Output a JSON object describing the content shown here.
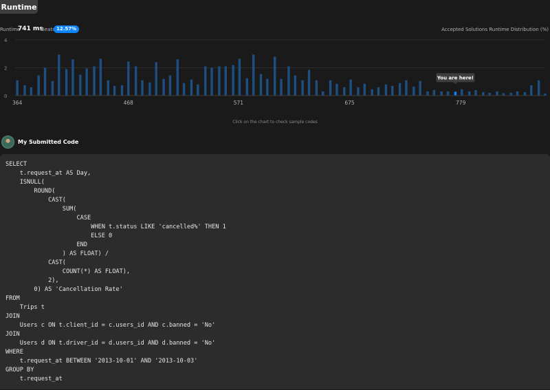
{
  "tabs": {
    "runtime": "Runtime"
  },
  "stats": {
    "runtime_label": "Runtime",
    "runtime_value": "741 ms",
    "beats_label": "Beats",
    "beats_value": "12.57%",
    "distribution_label": "Accepted Solutions Runtime Distribution (%)"
  },
  "chart_data": {
    "type": "bar",
    "ylim": [
      0,
      4
    ],
    "yticks": [
      "0",
      "2",
      "4"
    ],
    "xlim": [
      362,
      858
    ],
    "xticks": [
      364,
      468,
      571,
      675,
      779
    ],
    "grid": true,
    "bar_color": "#1e4f82",
    "highlight_color": "#0a84ff",
    "annotation": "You are here!",
    "highlight_index": 63,
    "x": [
      364,
      371,
      377,
      384,
      390,
      397,
      403,
      410,
      416,
      423,
      429,
      436,
      442,
      449,
      455,
      462,
      468,
      475,
      481,
      488,
      494,
      501,
      507,
      514,
      520,
      527,
      533,
      540,
      546,
      553,
      559,
      566,
      572,
      579,
      585,
      592,
      598,
      605,
      611,
      618,
      624,
      631,
      637,
      644,
      650,
      657,
      663,
      670,
      676,
      683,
      689,
      696,
      702,
      709,
      715,
      722,
      728,
      735,
      741,
      748,
      754,
      761,
      767,
      774,
      780,
      787,
      793,
      800,
      806,
      813,
      819,
      826,
      832,
      839,
      845,
      852,
      858
    ],
    "values": [
      1.1,
      0.75,
      0.6,
      1.45,
      2.0,
      1.05,
      2.95,
      1.9,
      2.6,
      1.5,
      1.95,
      2.1,
      2.65,
      1.1,
      0.7,
      0.75,
      2.45,
      2.1,
      1.1,
      0.95,
      2.4,
      1.2,
      1.45,
      2.6,
      0.9,
      1.15,
      0.8,
      2.1,
      2.0,
      2.1,
      2.1,
      2.2,
      2.65,
      1.25,
      2.95,
      1.55,
      1.2,
      2.8,
      1.2,
      2.1,
      1.45,
      1.1,
      1.85,
      1.1,
      0.3,
      1.1,
      0.85,
      0.6,
      1.15,
      0.6,
      0.85,
      0.45,
      0.6,
      0.8,
      0.7,
      0.9,
      1.1,
      0.65,
      1.05,
      0.3,
      0.4,
      0.3,
      0.3,
      0.28,
      0.45,
      0.3,
      0.4,
      0.25,
      0.2,
      0.3,
      0.18,
      0.2,
      0.3,
      0.25,
      0.75,
      1.1,
      0.15
    ]
  },
  "chart_hint": "Click on the chart to check sample codes",
  "submission": {
    "title": "My Submitted Code",
    "code": "SELECT\n    t.request_at AS Day,\n    ISNULL(\n        ROUND(\n            CAST(\n                SUM(\n                    CASE\n                        WHEN t.status LIKE 'cancelled%' THEN 1\n                        ELSE 0\n                    END\n                ) AS FLOAT) /\n            CAST(\n                COUNT(*) AS FLOAT),\n            2),\n        0) AS 'Cancellation Rate'\nFROM\n    Trips t\nJOIN\n    Users c ON t.client_id = c.users_id AND c.banned = 'No'\nJOIN\n    Users d ON t.driver_id = d.users_id AND d.banned = 'No'\nWHERE\n    t.request_at BETWEEN '2013-10-01' AND '2013-10-03'\nGROUP BY\n    t.request_at"
  }
}
